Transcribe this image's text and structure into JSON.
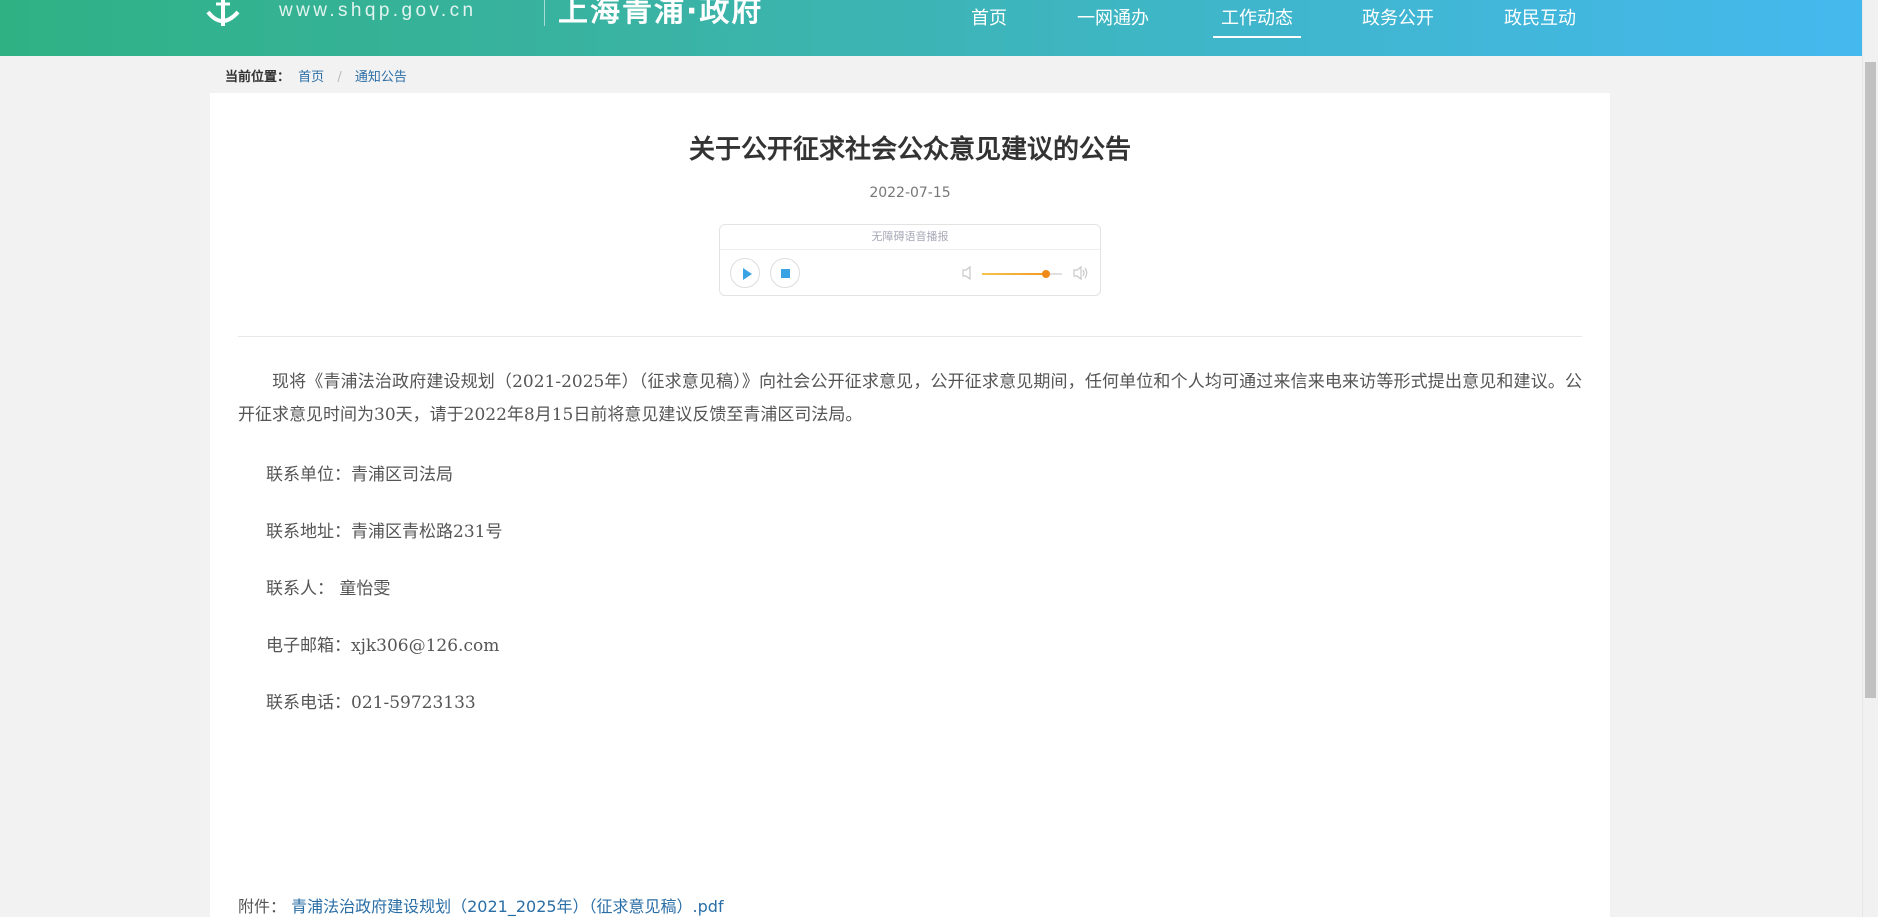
{
  "header": {
    "site_url": "www.shqp.gov.cn",
    "site_title": "上海青浦·政府",
    "nav": [
      {
        "label": "首页",
        "active": false
      },
      {
        "label": "一网通办",
        "active": false
      },
      {
        "label": "工作动态",
        "active": true
      },
      {
        "label": "政务公开",
        "active": false
      },
      {
        "label": "政民互动",
        "active": false
      }
    ]
  },
  "breadcrumb": {
    "label": "当前位置：",
    "items": [
      "首页",
      "通知公告"
    ],
    "separator": "/"
  },
  "article": {
    "title": "关于公开征求社会公众意见建议的公告",
    "date": "2022-07-15",
    "audio": {
      "label": "无障碍语音播报",
      "volume_percent": 80
    },
    "paragraph": "现将《青浦法治政府建设规划（2021-2025年）（征求意见稿）》向社会公开征求意见，公开征求意见期间，任何单位和个人均可通过来信来电来访等形式提出意见和建议。公开征求意见时间为30天，请于2022年8月15日前将意见建议反馈至青浦区司法局。",
    "contacts": [
      "联系单位：青浦区司法局",
      "联系地址：青浦区青松路231号",
      "联系人：  童怡雯",
      "电子邮箱：xjk306@126.com",
      "联系电话：021-59723133"
    ],
    "attachment": {
      "label": "附件：",
      "file": "青浦法治政府建设规划（2021_2025年）（征求意见稿）.pdf"
    }
  },
  "colors": {
    "header_start": "#2fb184",
    "header_end": "#45b8ee",
    "link": "#2a6ea6",
    "play_icon": "#3aa3e3",
    "volume": "#f08a16"
  }
}
